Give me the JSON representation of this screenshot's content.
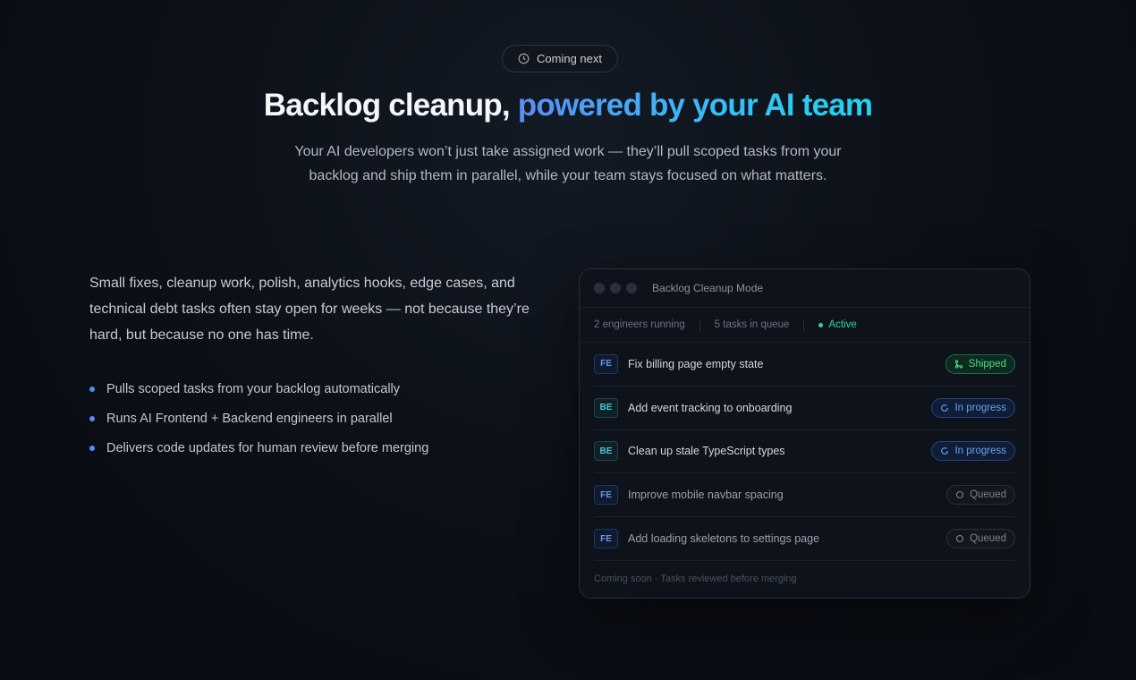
{
  "badge": {
    "label": "Coming next",
    "icon": "clock-icon"
  },
  "headline": {
    "part1": "Backlog cleanup,",
    "part2": "powered by your AI team"
  },
  "subtitle": "Your AI developers won’t just take assigned work — they’ll pull scoped tasks from your backlog and ship them in parallel, while your team stays focused on what matters.",
  "lead": "Small fixes, cleanup work, polish, analytics hooks, edge cases, and technical debt tasks often stay open for weeks — not because they’re hard, but because no one has time.",
  "bullets": [
    "Pulls scoped tasks from your backlog automatically",
    "Runs AI Frontend + Backend engineers in parallel",
    "Delivers code updates for human review before merging"
  ],
  "panel": {
    "title": "Backlog Cleanup Mode",
    "stats": {
      "engineers": "2 engineers running",
      "queue": "5 tasks in queue",
      "status": "Active"
    },
    "tasks": [
      {
        "tag": "FE",
        "title": "Fix billing page empty state",
        "status": "Shipped"
      },
      {
        "tag": "BE",
        "title": "Add event tracking to onboarding",
        "status": "In progress"
      },
      {
        "tag": "BE",
        "title": "Clean up stale TypeScript types",
        "status": "In progress"
      },
      {
        "tag": "FE",
        "title": "Improve mobile navbar spacing",
        "status": "Queued"
      },
      {
        "tag": "FE",
        "title": "Add loading skeletons to settings page",
        "status": "Queued"
      }
    ],
    "footer": "Coming soon · Tasks reviewed before merging"
  },
  "colors": {
    "accent_blue": "#4f8ff7",
    "shipped_green": "#4ade80",
    "active_green": "#34d399"
  }
}
